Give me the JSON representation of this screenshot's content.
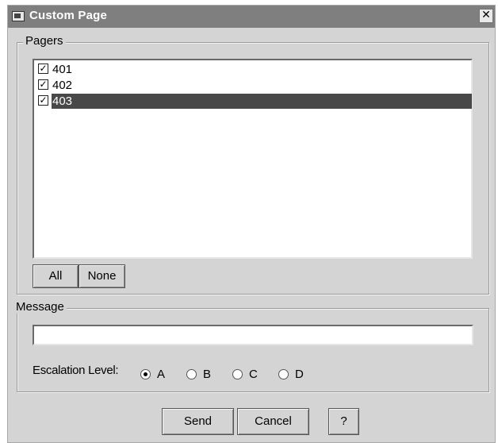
{
  "window": {
    "title": "Custom Page",
    "close_glyph": "✕"
  },
  "pagers": {
    "legend": "Pagers",
    "items": [
      {
        "label": "401",
        "checked": true,
        "selected": false
      },
      {
        "label": "402",
        "checked": true,
        "selected": false
      },
      {
        "label": "403",
        "checked": true,
        "selected": true
      }
    ],
    "all_label": "All",
    "none_label": "None"
  },
  "message": {
    "legend": "Message",
    "value": "",
    "escalation_label": "Escalation Level:",
    "levels": [
      {
        "label": "A",
        "checked": true
      },
      {
        "label": "B",
        "checked": false
      },
      {
        "label": "C",
        "checked": false
      },
      {
        "label": "D",
        "checked": false
      }
    ]
  },
  "footer": {
    "send_label": "Send",
    "cancel_label": "Cancel",
    "help_label": "?"
  }
}
